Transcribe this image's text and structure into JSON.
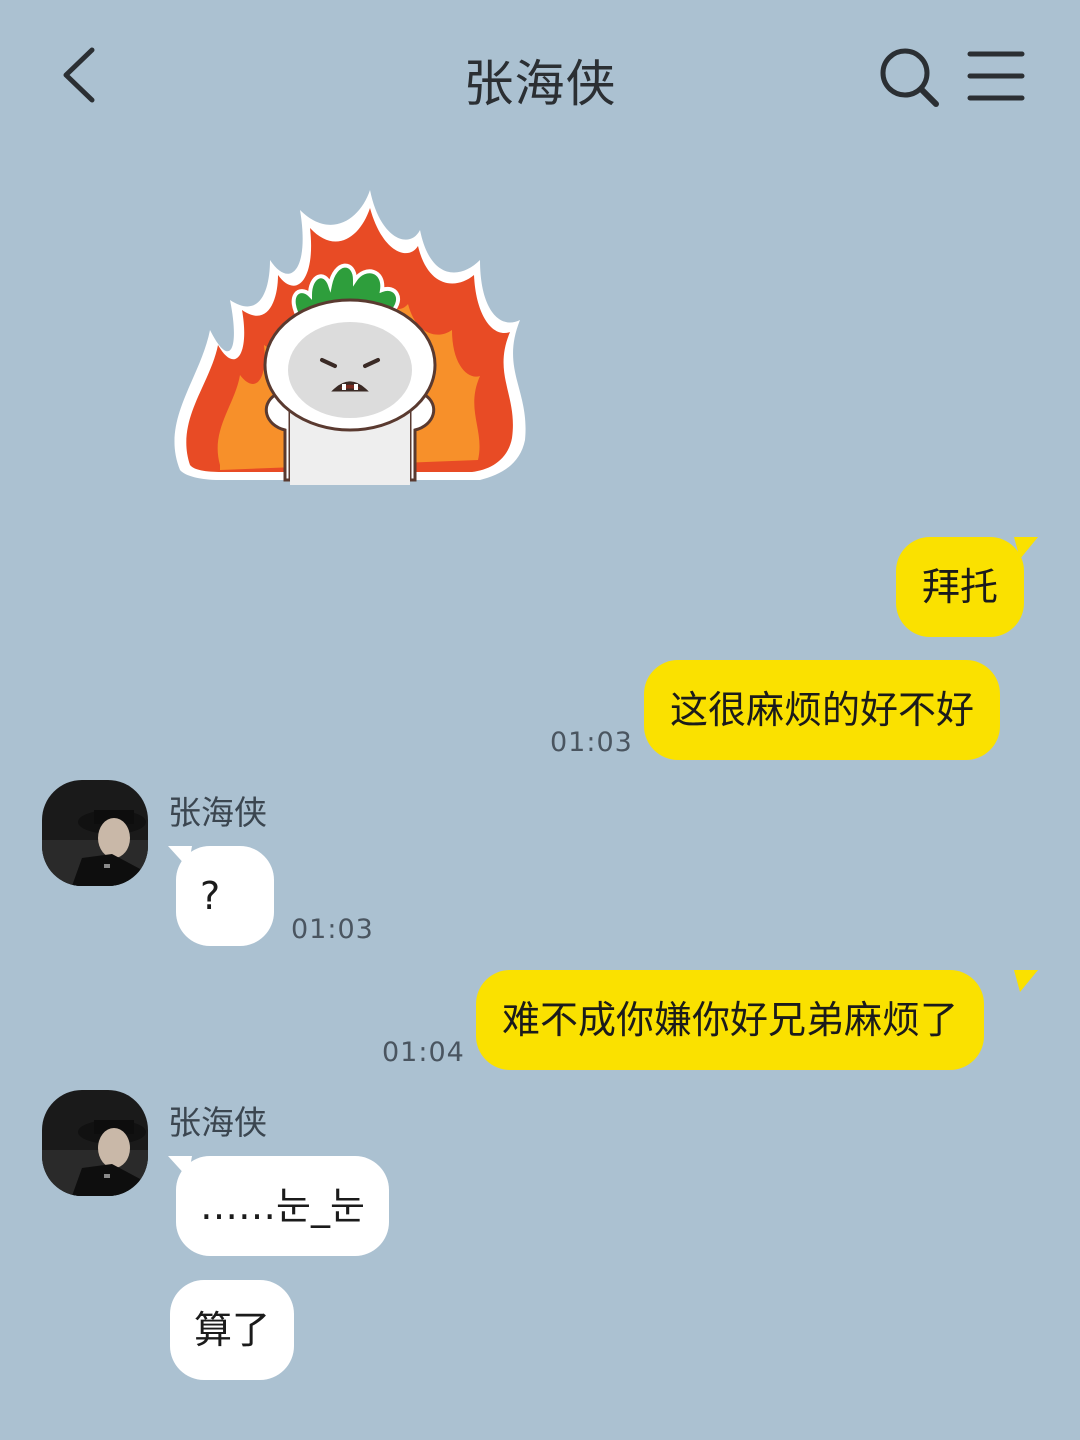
{
  "header": {
    "title": "张海侠",
    "back_icon": "chevron-left-icon",
    "search_icon": "search-icon",
    "menu_icon": "hamburger-menu-icon"
  },
  "colors": {
    "background": "#abc1d1",
    "outgoing_bubble": "#fae100",
    "incoming_bubble": "#ffffff"
  },
  "messages": {
    "sticker": {
      "type": "sticker",
      "description_icon": "angry-fire-sticker-icon"
    },
    "out1": {
      "text": "拜托"
    },
    "out2": {
      "text": "这很麻烦的好不好",
      "time": "01:03"
    },
    "in1": {
      "sender": "张海侠",
      "text": "?",
      "time": "01:03"
    },
    "out3": {
      "text": "难不成你嫌你好兄弟麻烦了",
      "time": "01:04"
    },
    "in2": {
      "sender": "张海侠",
      "text": "……눈_눈"
    },
    "in3": {
      "text": "算了"
    }
  }
}
